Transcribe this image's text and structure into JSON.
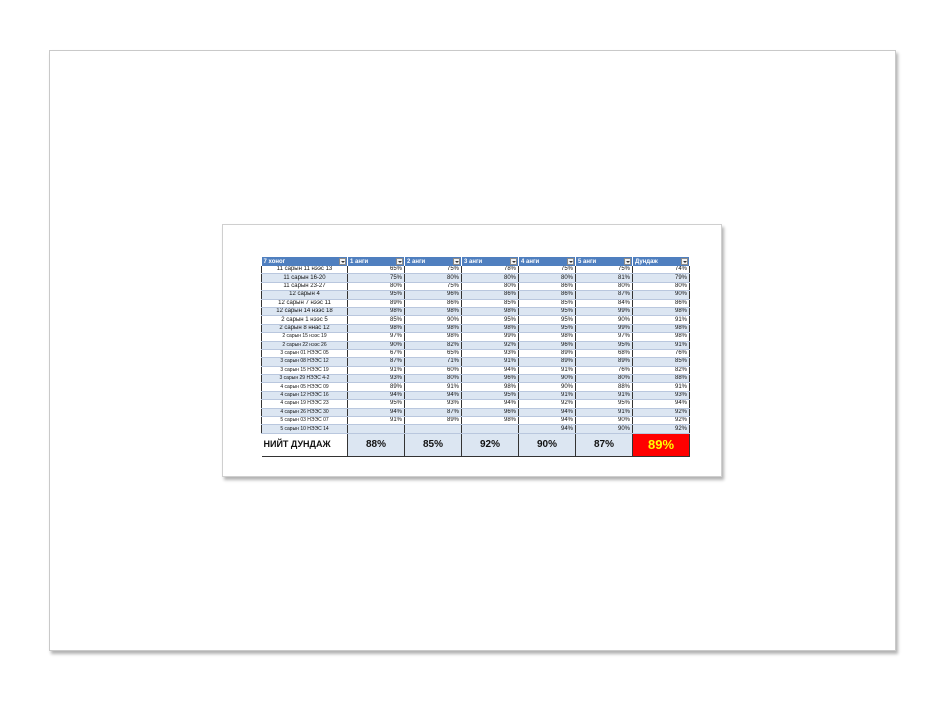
{
  "headers": [
    "7 хоног",
    "1 анги",
    "2 анги",
    "3 анги",
    "4 анги",
    "5 анги",
    "Дундаж"
  ],
  "rows": [
    {
      "label": "11 сарын 11 нээс 13",
      "values": [
        "65%",
        "75%",
        "78%",
        "75%",
        "75%",
        "74%"
      ]
    },
    {
      "label": "11 сарын 16-20",
      "values": [
        "75%",
        "80%",
        "80%",
        "80%",
        "81%",
        "79%"
      ]
    },
    {
      "label": "11 сарын 23-27",
      "values": [
        "80%",
        "75%",
        "80%",
        "86%",
        "80%",
        "80%"
      ]
    },
    {
      "label": "12 сарын 4",
      "values": [
        "95%",
        "96%",
        "86%",
        "86%",
        "87%",
        "90%"
      ]
    },
    {
      "label": "12 сарын 7 нээс 11",
      "values": [
        "89%",
        "86%",
        "85%",
        "85%",
        "84%",
        "86%"
      ]
    },
    {
      "label": "12 сарын 14 нээс 18",
      "values": [
        "98%",
        "98%",
        "98%",
        "95%",
        "99%",
        "98%"
      ]
    },
    {
      "label": "2 сарын 1 нээс 5",
      "values": [
        "85%",
        "90%",
        "95%",
        "95%",
        "90%",
        "91%"
      ]
    },
    {
      "label": "2 сарын 8 ннас 12",
      "values": [
        "98%",
        "98%",
        "98%",
        "95%",
        "99%",
        "98%"
      ]
    },
    {
      "label": "2 сарын 15 нээс 19",
      "values": [
        "97%",
        "98%",
        "99%",
        "98%",
        "97%",
        "98%"
      ]
    },
    {
      "label": "2 сарын 22 нээс 26",
      "values": [
        "90%",
        "82%",
        "92%",
        "96%",
        "95%",
        "91%"
      ]
    },
    {
      "label": "3 сарын 01 НЭЭС 05",
      "values": [
        "67%",
        "65%",
        "93%",
        "89%",
        "68%",
        "76%"
      ]
    },
    {
      "label": "3 сарын 08 НЭЭС 12",
      "values": [
        "87%",
        "71%",
        "91%",
        "89%",
        "89%",
        "85%"
      ]
    },
    {
      "label": "3 сарын 15 НЭЭС 19",
      "values": [
        "91%",
        "60%",
        "94%",
        "91%",
        "76%",
        "82%"
      ]
    },
    {
      "label": "3 сарын 29 НЭЭС 4-2",
      "values": [
        "93%",
        "80%",
        "96%",
        "90%",
        "80%",
        "88%"
      ]
    },
    {
      "label": "4 сарын 05 НЭЭС 09",
      "values": [
        "89%",
        "91%",
        "98%",
        "90%",
        "88%",
        "91%"
      ]
    },
    {
      "label": "4 сарын 12 НЭЭС 16",
      "values": [
        "94%",
        "94%",
        "95%",
        "91%",
        "91%",
        "93%"
      ]
    },
    {
      "label": "4 сарын 19 НЭЭС 23",
      "values": [
        "95%",
        "93%",
        "94%",
        "92%",
        "95%",
        "94%"
      ]
    },
    {
      "label": "4 сарын 26 НЭЭС 30",
      "values": [
        "94%",
        "87%",
        "96%",
        "94%",
        "91%",
        "92%"
      ]
    },
    {
      "label": "5 сарын 03 НЭЭС 07",
      "values": [
        "91%",
        "89%",
        "98%",
        "94%",
        "90%",
        "92%"
      ]
    },
    {
      "label": "5 сарын 10 НЭЭС 14",
      "values": [
        "",
        "",
        "",
        "94%",
        "90%",
        "92%"
      ]
    }
  ],
  "total": {
    "label": "НИЙТ ДУНДАЖ",
    "values": [
      "88%",
      "85%",
      "92%",
      "90%",
      "87%",
      "89%"
    ]
  },
  "colors": {
    "header": "#4f7fbf",
    "band": "#dce6f2",
    "highlight": "#ff0000",
    "highlight_text": "#ffff00"
  }
}
